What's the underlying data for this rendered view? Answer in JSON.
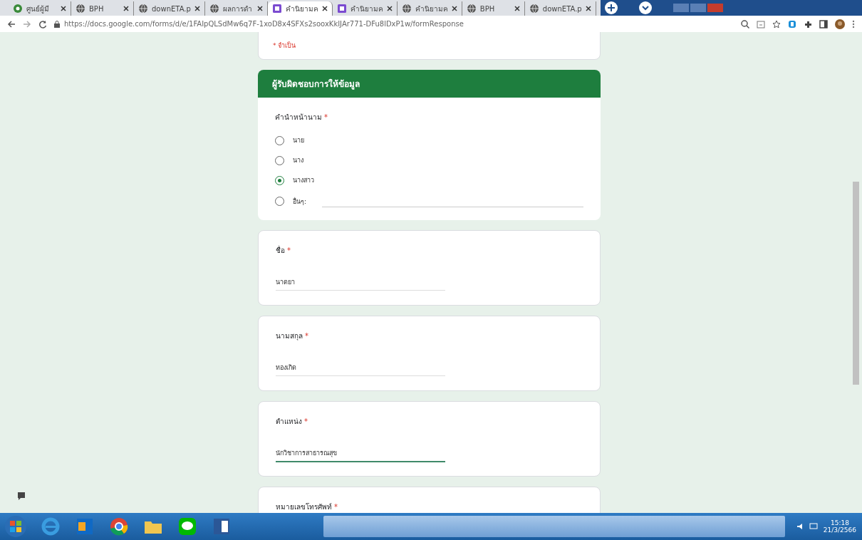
{
  "browser": {
    "tabs": [
      {
        "title": "ศูนย์ผู้มี",
        "kind": "app",
        "selected": false
      },
      {
        "title": "BPH",
        "kind": "web",
        "selected": false
      },
      {
        "title": "downETA.p",
        "kind": "web",
        "selected": false
      },
      {
        "title": "ผลการดำ",
        "kind": "web",
        "selected": false
      },
      {
        "title": "คำนิยามค",
        "kind": "form",
        "selected": true
      },
      {
        "title": "คำนิยามค",
        "kind": "form",
        "selected": false
      },
      {
        "title": "คำนิยามค",
        "kind": "web",
        "selected": false
      },
      {
        "title": "BPH",
        "kind": "web",
        "selected": false
      },
      {
        "title": "downETA.p",
        "kind": "web",
        "selected": false
      }
    ],
    "url": "https://docs.google.com/forms/d/e/1FAIpQLSdMw6q7F-1xoD8x4SFXs2sooxKkIJAr771-DFu8lDxP1w/formResponse"
  },
  "form": {
    "required_note": "* จำเป็น",
    "section_title": "ผู้รับผิดชอบการให้ข้อมูล",
    "questions": [
      {
        "kind": "radio",
        "label": "คำนำหน้านาม",
        "required_mark": "*",
        "options": [
          {
            "label": "นาย",
            "kind": "choice",
            "selected": false
          },
          {
            "label": "นาง",
            "kind": "choice",
            "selected": false
          },
          {
            "label": "นางสาว",
            "kind": "choice",
            "selected": true
          },
          {
            "label": "อื่นๆ:",
            "kind": "other",
            "selected": false
          }
        ]
      },
      {
        "kind": "text",
        "label": "ชื่อ",
        "required_mark": "*",
        "value": "นาตยา",
        "focused": false
      },
      {
        "kind": "text",
        "label": "นามสกุล",
        "required_mark": "*",
        "value": "ทองเกิด",
        "focused": false
      },
      {
        "kind": "text",
        "label": "ตำแหน่ง",
        "required_mark": "*",
        "value": "นักวิชาการสาธารณสุข",
        "focused": true
      },
      {
        "kind": "text",
        "label": "หมายเลขโทรศัพท์",
        "required_mark": "*"
      }
    ]
  },
  "taskbar": {
    "time": "15:18",
    "date": "21/3/2566"
  }
}
